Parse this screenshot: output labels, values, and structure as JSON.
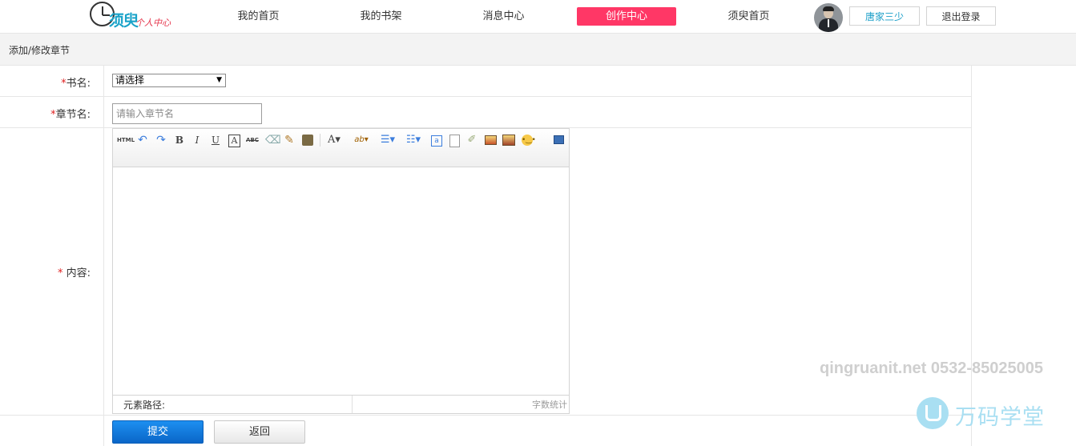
{
  "header": {
    "logo_text": "须臾",
    "logo_sub": "个人中心",
    "nav": [
      {
        "label": "我的首页",
        "active": false
      },
      {
        "label": "我的书架",
        "active": false
      },
      {
        "label": "消息中心",
        "active": false
      },
      {
        "label": "创作中心",
        "active": true
      },
      {
        "label": "须臾首页",
        "active": false
      }
    ],
    "user_name": "唐家三少",
    "logout_label": "退出登录",
    "accent_color": "#ff3766"
  },
  "breadcrumb": "添加/修改章节",
  "form": {
    "book_label": "书名:",
    "book_select_value": "请选择",
    "chapter_label": "章节名:",
    "chapter_placeholder": "请输入章节名",
    "content_label": "内容:",
    "required_mark": "*"
  },
  "editor": {
    "toolbar_icons": [
      "html-icon",
      "undo-icon",
      "redo-icon",
      "bold-icon",
      "italic-icon",
      "underline-icon",
      "font-border-icon",
      "strikethrough-icon",
      "eraser-icon",
      "format-brush-icon",
      "paste-icon",
      "font-color-icon",
      "highlight-color-icon",
      "ordered-list-icon",
      "unordered-list-icon",
      "anchor-icon",
      "page-icon",
      "clean-icon",
      "image-icon",
      "multi-image-icon",
      "emoji-icon",
      "preview-icon"
    ],
    "status_path_label": "元素路径:",
    "word_count_label": "字数统计"
  },
  "buttons": {
    "submit": "提交",
    "back": "返回"
  },
  "watermark": {
    "contact": "qingruanit.net 0532-85025005",
    "brand": "万码学堂"
  }
}
